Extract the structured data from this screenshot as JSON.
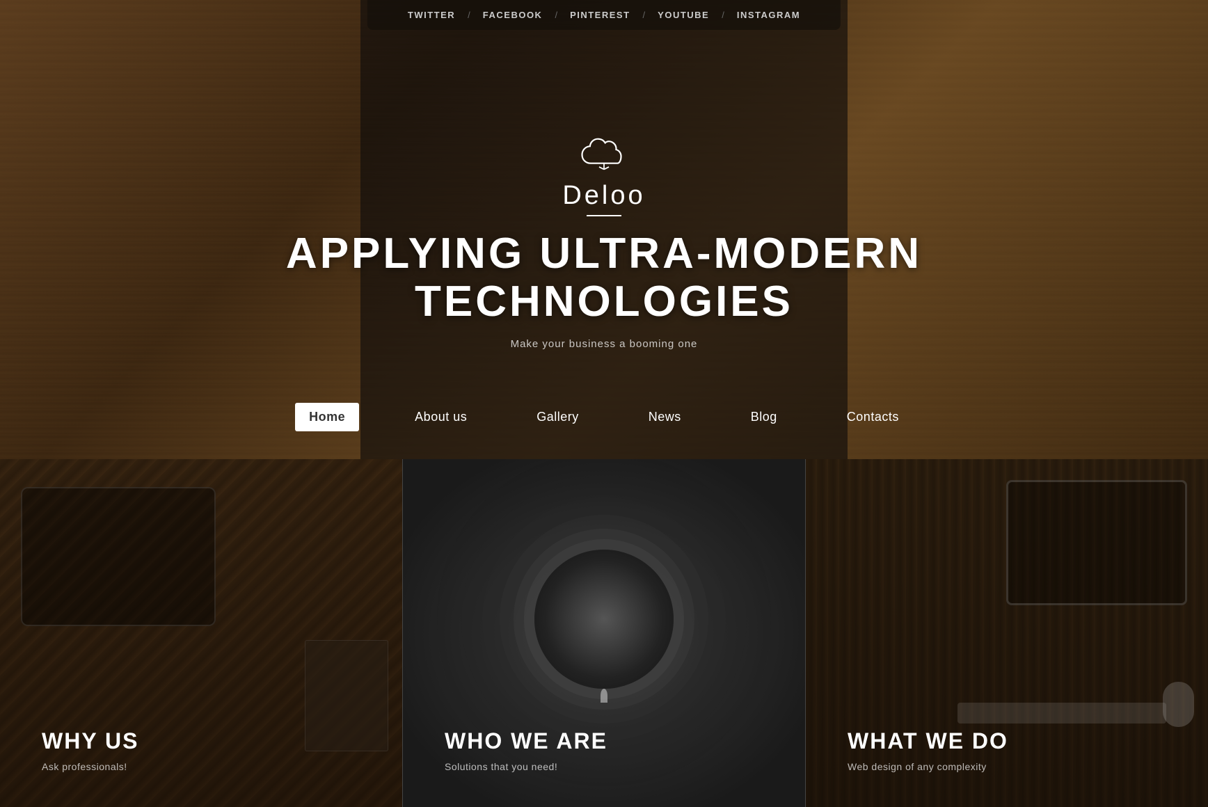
{
  "social": {
    "items": [
      "TWITTER",
      "FACEBOOK",
      "PINTEREST",
      "YOUTUBE",
      "INSTAGRAM"
    ]
  },
  "hero": {
    "brand": "Deloo",
    "headline_line1": "APPLYING ULTRA-MODERN",
    "headline_line2": "TECHNOLOGIES",
    "subtext": "Make your business a booming one"
  },
  "nav": {
    "items": [
      {
        "label": "Home",
        "active": true
      },
      {
        "label": "About us",
        "active": false
      },
      {
        "label": "Gallery",
        "active": false
      },
      {
        "label": "News",
        "active": false
      },
      {
        "label": "Blog",
        "active": false
      },
      {
        "label": "Contacts",
        "active": false
      }
    ]
  },
  "panels": [
    {
      "id": "why-us",
      "title": "WHY US",
      "subtitle": "Ask professionals!"
    },
    {
      "id": "who-we-are",
      "title": "WHO WE ARE",
      "subtitle": "Solutions that you need!"
    },
    {
      "id": "what-we-do",
      "title": "WHAT WE DO",
      "subtitle": "Web design of any complexity"
    }
  ]
}
